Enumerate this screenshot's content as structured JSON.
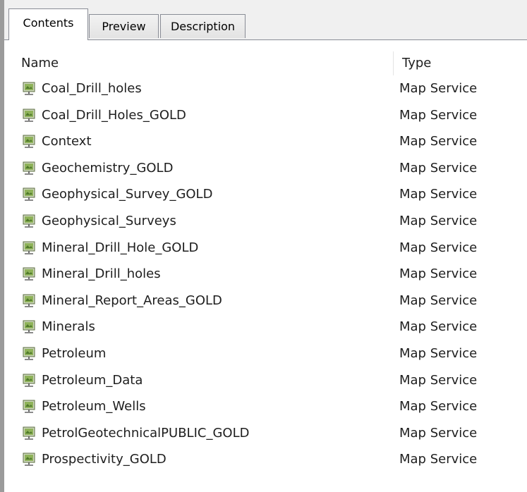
{
  "tabs": [
    {
      "label": "Contents",
      "active": true
    },
    {
      "label": "Preview",
      "active": false
    },
    {
      "label": "Description",
      "active": false
    }
  ],
  "columns": {
    "name": "Name",
    "type": "Type"
  },
  "rows": [
    {
      "name": "Coal_Drill_holes",
      "type": "Map Service",
      "icon": "map-service-icon"
    },
    {
      "name": "Coal_Drill_Holes_GOLD",
      "type": "Map Service",
      "icon": "map-service-icon"
    },
    {
      "name": "Context",
      "type": "Map Service",
      "icon": "map-service-icon"
    },
    {
      "name": "Geochemistry_GOLD",
      "type": "Map Service",
      "icon": "map-service-icon"
    },
    {
      "name": "Geophysical_Survey_GOLD",
      "type": "Map Service",
      "icon": "map-service-icon"
    },
    {
      "name": "Geophysical_Surveys",
      "type": "Map Service",
      "icon": "map-service-icon"
    },
    {
      "name": "Mineral_Drill_Hole_GOLD",
      "type": "Map Service",
      "icon": "map-service-icon"
    },
    {
      "name": "Mineral_Drill_holes",
      "type": "Map Service",
      "icon": "map-service-icon"
    },
    {
      "name": "Mineral_Report_Areas_GOLD",
      "type": "Map Service",
      "icon": "map-service-icon"
    },
    {
      "name": "Minerals",
      "type": "Map Service",
      "icon": "map-service-icon"
    },
    {
      "name": "Petroleum",
      "type": "Map Service",
      "icon": "map-service-icon"
    },
    {
      "name": "Petroleum_Data",
      "type": "Map Service",
      "icon": "map-service-icon"
    },
    {
      "name": "Petroleum_Wells",
      "type": "Map Service",
      "icon": "map-service-icon"
    },
    {
      "name": "PetrolGeotechnicalPUBLIC_GOLD",
      "type": "Map Service",
      "icon": "map-service-icon"
    },
    {
      "name": "Prospectivity_GOLD",
      "type": "Map Service",
      "icon": "map-service-icon"
    }
  ]
}
